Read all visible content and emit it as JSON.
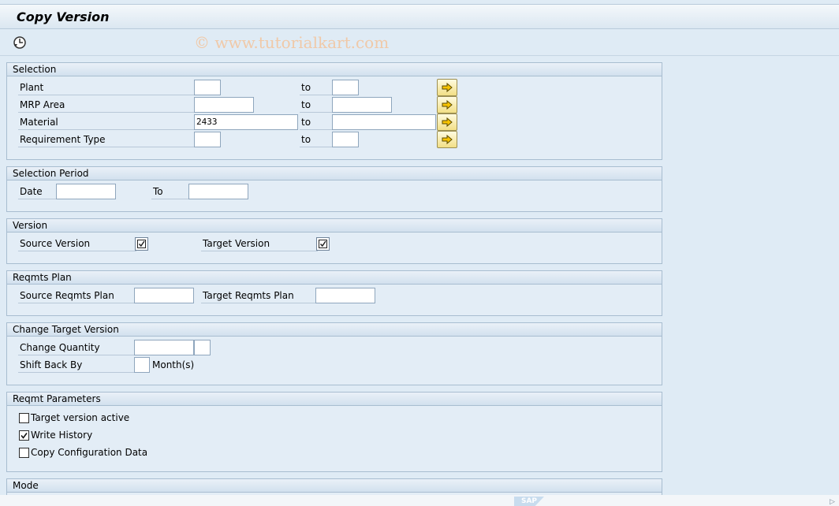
{
  "title": "Copy Version",
  "watermark": "© www.tutorialkart.com",
  "selection": {
    "header": "Selection",
    "to_label": "to",
    "rows": [
      {
        "label": "Plant",
        "from": "",
        "to": ""
      },
      {
        "label": "MRP Area",
        "from": "",
        "to": ""
      },
      {
        "label": "Material",
        "from": "2433",
        "to": ""
      },
      {
        "label": "Requirement Type",
        "from": "",
        "to": ""
      }
    ]
  },
  "selection_period": {
    "header": "Selection Period",
    "date_label": "Date",
    "to_label": "To",
    "date_from": "",
    "date_to": ""
  },
  "version": {
    "header": "Version",
    "source_label": "Source Version",
    "target_label": "Target Version",
    "source_checked": true,
    "target_checked": true
  },
  "reqmts_plan": {
    "header": "Reqmts Plan",
    "source_label": "Source Reqmts Plan",
    "target_label": "Target Reqmts Plan",
    "source_value": "",
    "target_value": ""
  },
  "change_target": {
    "header": "Change Target Version",
    "quantity_label": "Change Quantity",
    "shift_label": "Shift Back By",
    "months_label": "Month(s)",
    "quantity_value": "",
    "quantity_unit": "",
    "shift_value": ""
  },
  "reqmt_parameters": {
    "header": "Reqmt Parameters",
    "options": [
      {
        "label": "Target version active",
        "checked": false
      },
      {
        "label": "Write History",
        "checked": true
      },
      {
        "label": "Copy Configuration Data",
        "checked": false
      }
    ]
  },
  "mode": {
    "header": "Mode"
  },
  "icons": {
    "execute": "execute-clock-icon",
    "multiple_selection": "multiple-selection-arrow-icon"
  },
  "colors": {
    "background": "#dfebf5",
    "multi_button": "#f2df86",
    "watermark": "#f0c9a8"
  }
}
